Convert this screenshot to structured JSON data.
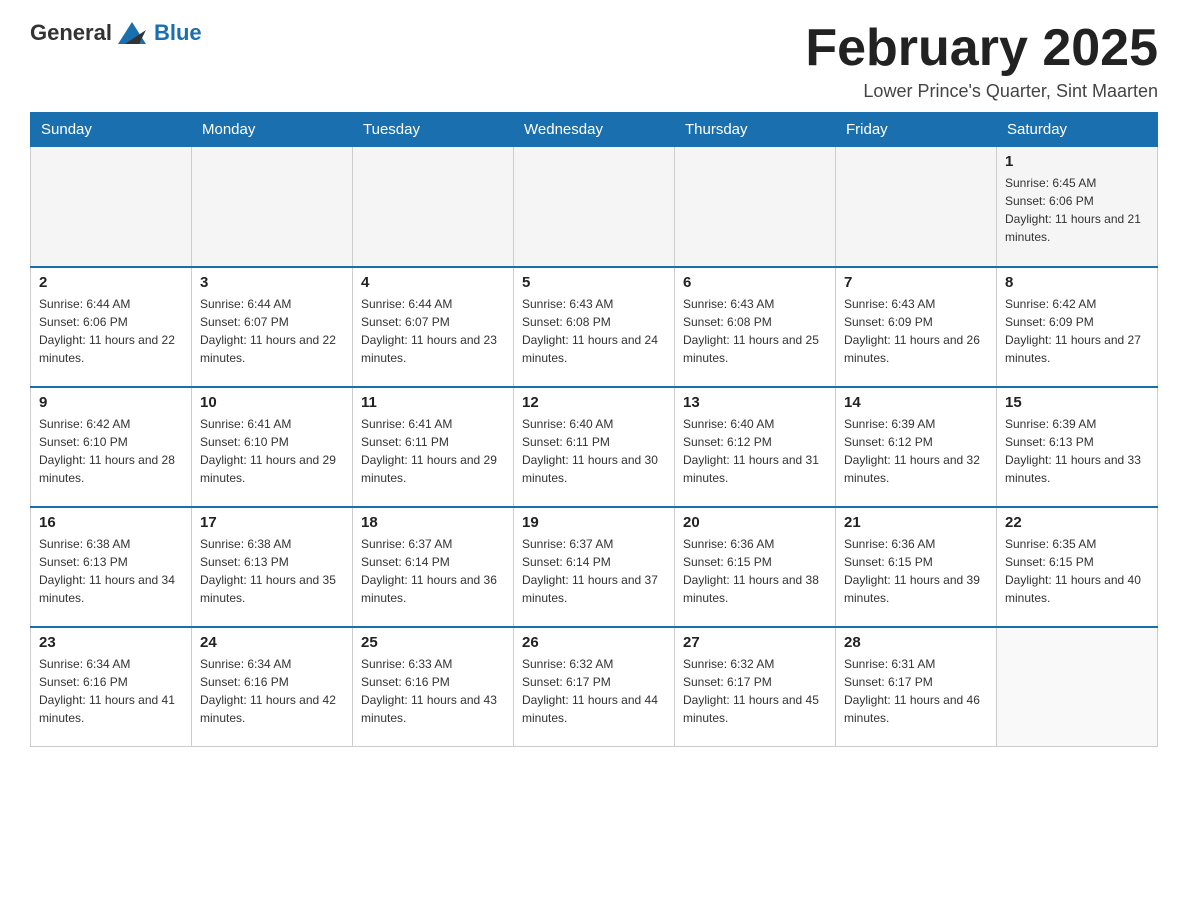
{
  "header": {
    "logo_general": "General",
    "logo_blue": "Blue",
    "title": "February 2025",
    "subtitle": "Lower Prince's Quarter, Sint Maarten"
  },
  "weekdays": [
    "Sunday",
    "Monday",
    "Tuesday",
    "Wednesday",
    "Thursday",
    "Friday",
    "Saturday"
  ],
  "weeks": [
    [
      {
        "day": "",
        "sunrise": "",
        "sunset": "",
        "daylight": ""
      },
      {
        "day": "",
        "sunrise": "",
        "sunset": "",
        "daylight": ""
      },
      {
        "day": "",
        "sunrise": "",
        "sunset": "",
        "daylight": ""
      },
      {
        "day": "",
        "sunrise": "",
        "sunset": "",
        "daylight": ""
      },
      {
        "day": "",
        "sunrise": "",
        "sunset": "",
        "daylight": ""
      },
      {
        "day": "",
        "sunrise": "",
        "sunset": "",
        "daylight": ""
      },
      {
        "day": "1",
        "sunrise": "Sunrise: 6:45 AM",
        "sunset": "Sunset: 6:06 PM",
        "daylight": "Daylight: 11 hours and 21 minutes."
      }
    ],
    [
      {
        "day": "2",
        "sunrise": "Sunrise: 6:44 AM",
        "sunset": "Sunset: 6:06 PM",
        "daylight": "Daylight: 11 hours and 22 minutes."
      },
      {
        "day": "3",
        "sunrise": "Sunrise: 6:44 AM",
        "sunset": "Sunset: 6:07 PM",
        "daylight": "Daylight: 11 hours and 22 minutes."
      },
      {
        "day": "4",
        "sunrise": "Sunrise: 6:44 AM",
        "sunset": "Sunset: 6:07 PM",
        "daylight": "Daylight: 11 hours and 23 minutes."
      },
      {
        "day": "5",
        "sunrise": "Sunrise: 6:43 AM",
        "sunset": "Sunset: 6:08 PM",
        "daylight": "Daylight: 11 hours and 24 minutes."
      },
      {
        "day": "6",
        "sunrise": "Sunrise: 6:43 AM",
        "sunset": "Sunset: 6:08 PM",
        "daylight": "Daylight: 11 hours and 25 minutes."
      },
      {
        "day": "7",
        "sunrise": "Sunrise: 6:43 AM",
        "sunset": "Sunset: 6:09 PM",
        "daylight": "Daylight: 11 hours and 26 minutes."
      },
      {
        "day": "8",
        "sunrise": "Sunrise: 6:42 AM",
        "sunset": "Sunset: 6:09 PM",
        "daylight": "Daylight: 11 hours and 27 minutes."
      }
    ],
    [
      {
        "day": "9",
        "sunrise": "Sunrise: 6:42 AM",
        "sunset": "Sunset: 6:10 PM",
        "daylight": "Daylight: 11 hours and 28 minutes."
      },
      {
        "day": "10",
        "sunrise": "Sunrise: 6:41 AM",
        "sunset": "Sunset: 6:10 PM",
        "daylight": "Daylight: 11 hours and 29 minutes."
      },
      {
        "day": "11",
        "sunrise": "Sunrise: 6:41 AM",
        "sunset": "Sunset: 6:11 PM",
        "daylight": "Daylight: 11 hours and 29 minutes."
      },
      {
        "day": "12",
        "sunrise": "Sunrise: 6:40 AM",
        "sunset": "Sunset: 6:11 PM",
        "daylight": "Daylight: 11 hours and 30 minutes."
      },
      {
        "day": "13",
        "sunrise": "Sunrise: 6:40 AM",
        "sunset": "Sunset: 6:12 PM",
        "daylight": "Daylight: 11 hours and 31 minutes."
      },
      {
        "day": "14",
        "sunrise": "Sunrise: 6:39 AM",
        "sunset": "Sunset: 6:12 PM",
        "daylight": "Daylight: 11 hours and 32 minutes."
      },
      {
        "day": "15",
        "sunrise": "Sunrise: 6:39 AM",
        "sunset": "Sunset: 6:13 PM",
        "daylight": "Daylight: 11 hours and 33 minutes."
      }
    ],
    [
      {
        "day": "16",
        "sunrise": "Sunrise: 6:38 AM",
        "sunset": "Sunset: 6:13 PM",
        "daylight": "Daylight: 11 hours and 34 minutes."
      },
      {
        "day": "17",
        "sunrise": "Sunrise: 6:38 AM",
        "sunset": "Sunset: 6:13 PM",
        "daylight": "Daylight: 11 hours and 35 minutes."
      },
      {
        "day": "18",
        "sunrise": "Sunrise: 6:37 AM",
        "sunset": "Sunset: 6:14 PM",
        "daylight": "Daylight: 11 hours and 36 minutes."
      },
      {
        "day": "19",
        "sunrise": "Sunrise: 6:37 AM",
        "sunset": "Sunset: 6:14 PM",
        "daylight": "Daylight: 11 hours and 37 minutes."
      },
      {
        "day": "20",
        "sunrise": "Sunrise: 6:36 AM",
        "sunset": "Sunset: 6:15 PM",
        "daylight": "Daylight: 11 hours and 38 minutes."
      },
      {
        "day": "21",
        "sunrise": "Sunrise: 6:36 AM",
        "sunset": "Sunset: 6:15 PM",
        "daylight": "Daylight: 11 hours and 39 minutes."
      },
      {
        "day": "22",
        "sunrise": "Sunrise: 6:35 AM",
        "sunset": "Sunset: 6:15 PM",
        "daylight": "Daylight: 11 hours and 40 minutes."
      }
    ],
    [
      {
        "day": "23",
        "sunrise": "Sunrise: 6:34 AM",
        "sunset": "Sunset: 6:16 PM",
        "daylight": "Daylight: 11 hours and 41 minutes."
      },
      {
        "day": "24",
        "sunrise": "Sunrise: 6:34 AM",
        "sunset": "Sunset: 6:16 PM",
        "daylight": "Daylight: 11 hours and 42 minutes."
      },
      {
        "day": "25",
        "sunrise": "Sunrise: 6:33 AM",
        "sunset": "Sunset: 6:16 PM",
        "daylight": "Daylight: 11 hours and 43 minutes."
      },
      {
        "day": "26",
        "sunrise": "Sunrise: 6:32 AM",
        "sunset": "Sunset: 6:17 PM",
        "daylight": "Daylight: 11 hours and 44 minutes."
      },
      {
        "day": "27",
        "sunrise": "Sunrise: 6:32 AM",
        "sunset": "Sunset: 6:17 PM",
        "daylight": "Daylight: 11 hours and 45 minutes."
      },
      {
        "day": "28",
        "sunrise": "Sunrise: 6:31 AM",
        "sunset": "Sunset: 6:17 PM",
        "daylight": "Daylight: 11 hours and 46 minutes."
      },
      {
        "day": "",
        "sunrise": "",
        "sunset": "",
        "daylight": ""
      }
    ]
  ]
}
